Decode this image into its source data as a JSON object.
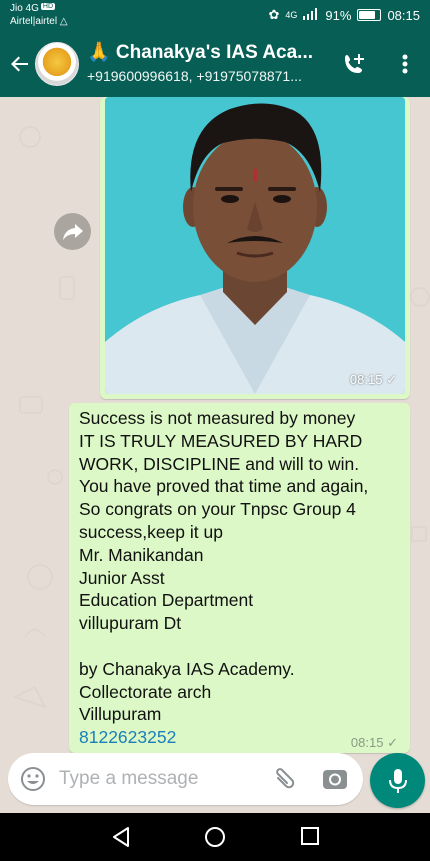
{
  "status_bar": {
    "carrier1": "Jio 4G",
    "hd_badge": "HD",
    "carrier2": "Airtel|airtel",
    "network": "4G",
    "battery": "91%",
    "time": "08:15"
  },
  "header": {
    "title": "🙏 Chanakya's IAS Aca...",
    "subtitle": "+919600996618, +91975078871..."
  },
  "messages": {
    "image_time": "08:15",
    "text_lines": [
      "Success is not measured by money",
      "IT IS TRULY MEASURED BY HARD",
      "WORK, DISCIPLINE and will to win.",
      "You have proved that time and again,",
      "So congrats on your Tnpsc Group 4",
      "success,keep it up",
      "Mr. Manikandan",
      "Junior Asst",
      "Education Department",
      "villupuram Dt",
      "",
      "by Chanakya IAS Academy.",
      "Collectorate arch",
      "Villupuram"
    ],
    "phone": "8122623252",
    "text_time": "08:15"
  },
  "input": {
    "placeholder": "Type a message"
  },
  "colors": {
    "header": "#075e54",
    "bubble": "#dcf8c6",
    "fab": "#00897b",
    "link": "#1a7fba"
  },
  "icons": [
    "back-arrow-icon",
    "avatar",
    "add-call-icon",
    "menu-dots-icon",
    "forward-icon",
    "read-check-icon",
    "emoji-icon",
    "attach-icon",
    "camera-icon",
    "mic-icon",
    "nav-back-icon",
    "nav-home-icon",
    "nav-recent-icon"
  ]
}
